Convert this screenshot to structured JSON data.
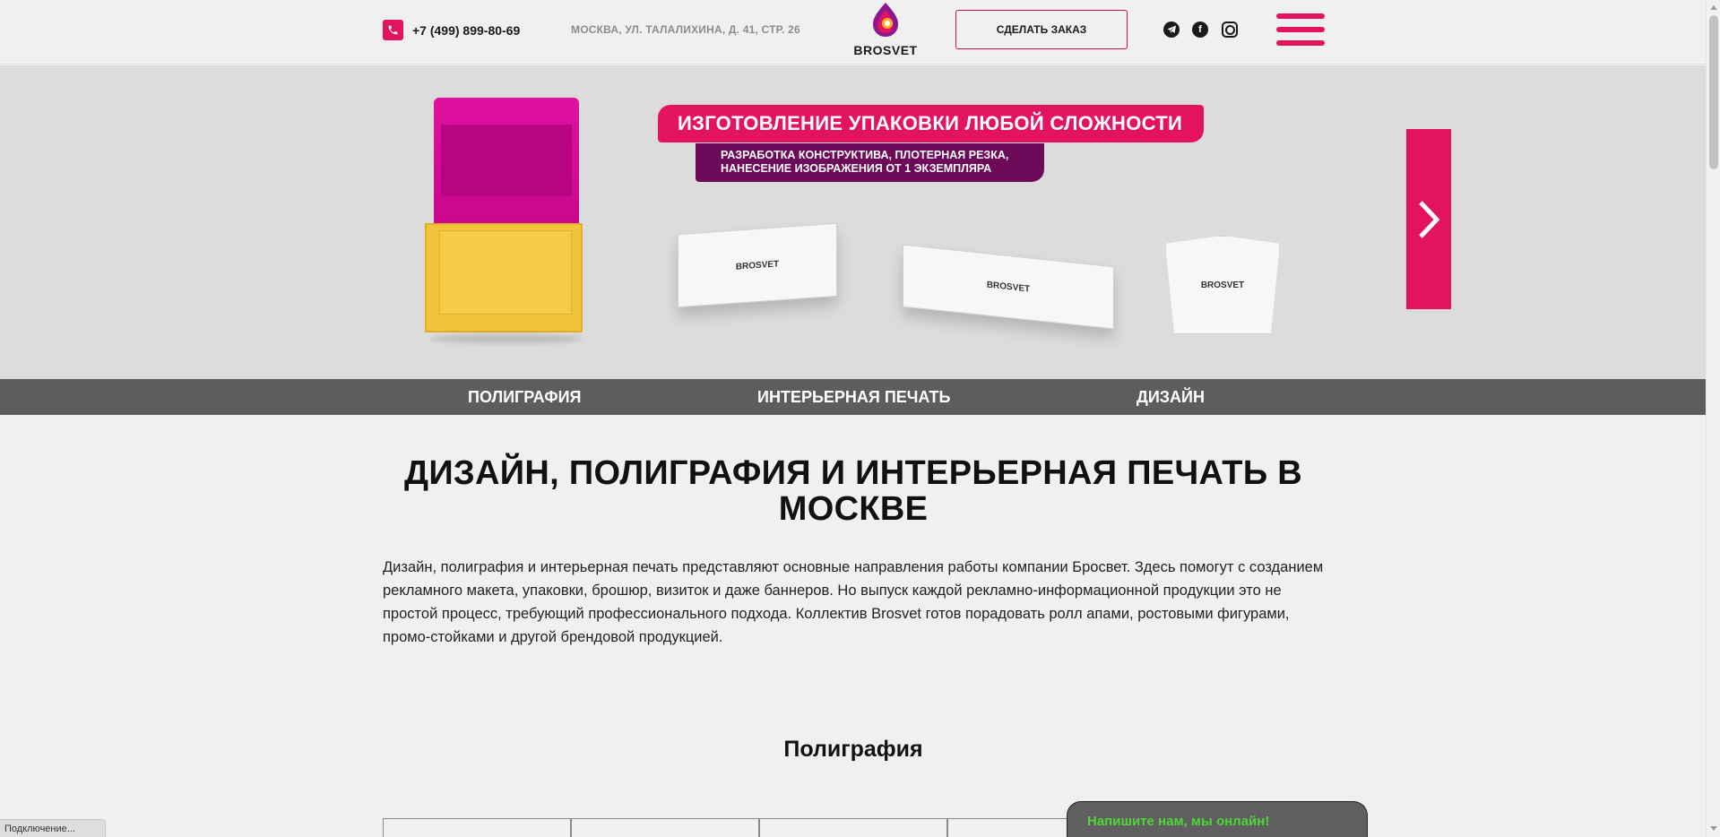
{
  "header": {
    "phone": "+7 (499) 899-80-69",
    "address": "МОСКВА, УЛ. ТАЛАЛИХИНА, Д. 41, СТР. 26",
    "logo_text": "BROSVET",
    "order_button": "СДЕЛАТЬ ЗАКАЗ",
    "social": [
      {
        "icon": "telegram-icon"
      },
      {
        "icon": "facebook-icon"
      },
      {
        "icon": "instagram-icon"
      }
    ],
    "menu_icon": "hamburger-menu-icon"
  },
  "hero": {
    "title": "ИЗГОТОВЛЕНИЕ УПАКОВКИ ЛЮБОЙ СЛОЖНОСТИ",
    "subtitle_line1": "РАЗРАБОТКА КОНСТРУКТИВА, ПЛОТЕРНАЯ РЕЗКА,",
    "subtitle_line2": "НАНЕСЕНИЕ ИЗОБРАЖЕНИЯ ОТ 1 ЭКЗЕМПЛЯРА",
    "box_logo_text": "BROSVET",
    "next_icon": "chevron-right-icon"
  },
  "categories": [
    "ПОЛИГРАФИЯ",
    "ИНТЕРЬЕРНАЯ ПЕЧАТЬ",
    "ДИЗАЙН"
  ],
  "main": {
    "title": "ДИЗАЙН, ПОЛИГРАФИЯ И ИНТЕРЬЕРНАЯ ПЕЧАТЬ В МОСКВЕ",
    "intro": "Дизайн, полиграфия и интерьерная печать представляют основные направления работы компании Бросвет. Здесь помогут с созданием рекламного макета, упаковки, брошюр, визиток и даже баннеров. Но выпуск каждой рекламно-информационной продукции это не простой процесс, требующий профессионального подхода. Коллектив Brosvet готов порадовать ролл апами, ростовыми фигурами, промо-стойками и другой брендовой продукцией.",
    "section_title": "Полиграфия"
  },
  "chat": {
    "text": "Напишите нам, мы онлайн!"
  },
  "status_bar": {
    "text": "Подключение..."
  },
  "colors": {
    "accent": "#e3135f",
    "accent_dark": "#6d0a59",
    "nav_bg": "#5e5d5d",
    "chat_text": "#4fd43a"
  }
}
